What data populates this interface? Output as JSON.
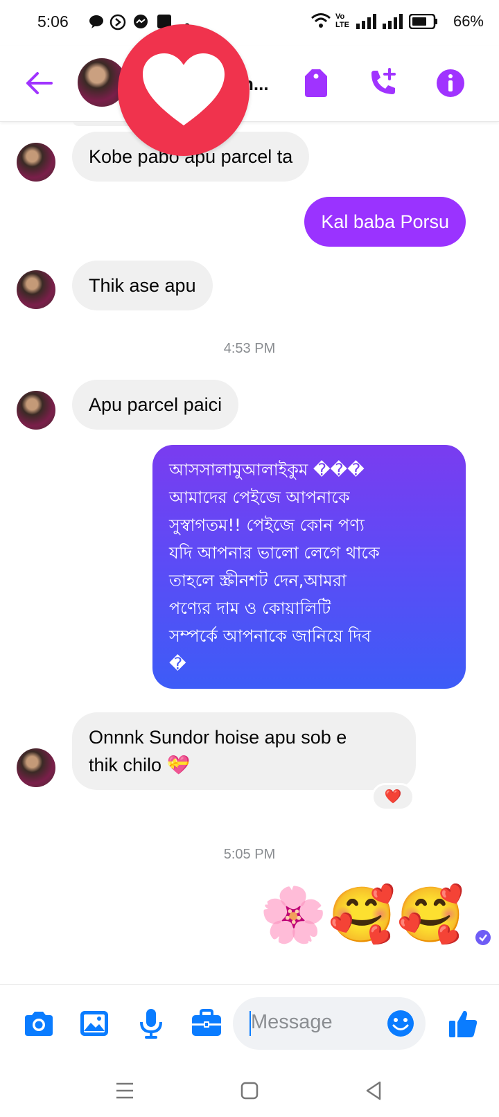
{
  "status_bar": {
    "time": "5:06",
    "network_label": "Vo LTE",
    "battery": "66%"
  },
  "header": {
    "contact_name": "n...",
    "accent_color": "#a033ff",
    "heart_overlay_color": "#f0334d"
  },
  "messages": [
    {
      "from": "them",
      "text": "Kobe pabo apu parcel ta"
    },
    {
      "from": "me",
      "text": "Kal baba Porsu"
    },
    {
      "from": "them",
      "text": "Thik ase apu"
    },
    {
      "timestamp": "4:53 PM"
    },
    {
      "from": "them",
      "text": "Apu parcel paici"
    },
    {
      "from": "me",
      "lines": [
        "আসসালামুআলাইকুম ���",
        "আমাদের পেইজে আপনাকে",
        "সুস্বাগতম!!  পেইজে কোন পণ্য",
        "যদি আপনার ভালো লেগে থাকে",
        "তাহলে স্ক্রীনশট দেন,আমরা",
        "পণ্যের দাম ও কোয়ালিটি",
        "সম্পর্কে আপনাকে জানিয়ে দিব",
        "�"
      ]
    },
    {
      "from": "them",
      "lines": [
        "Onnnk Sundor hoise apu sob e",
        "thik chilo 💝"
      ],
      "reaction": "❤️"
    },
    {
      "timestamp": "5:05 PM"
    },
    {
      "from": "me",
      "emojis": "🌸🥰🥰",
      "status": "seen"
    }
  ],
  "composer": {
    "placeholder": "Message",
    "icon_color": "#0a7cff"
  },
  "icons": [
    "back-arrow-icon",
    "tag-icon",
    "add-call-icon",
    "info-icon",
    "camera-icon",
    "gallery-icon",
    "microphone-icon",
    "briefcase-icon",
    "emoji-icon",
    "thumbs-up-icon",
    "menu-icon",
    "home-icon",
    "back-icon"
  ]
}
